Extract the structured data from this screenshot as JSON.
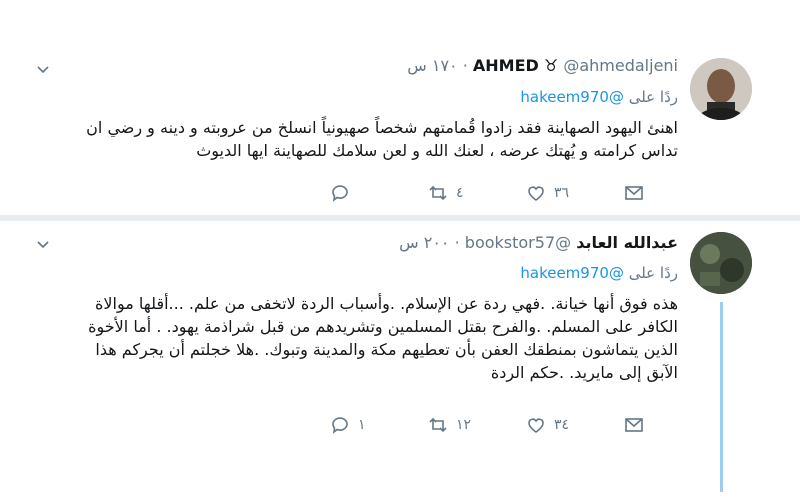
{
  "tweets": [
    {
      "name": "AHMED",
      "handle": "@ahmedaljeni",
      "time": "١٧٠ س",
      "reply_label": "ردًا على",
      "reply_to": "@hakeem970",
      "text": "اهنئ اليهود الصهاينة فقد زادوا قُمامتهم شخصاً صهيونياً انسلخ من عروبته و دينه و رضي ان تداس كرامته و يُهتك عرضه ، لعنك الله و لعن سلامك للصهاينة ايها الديوث",
      "actions": {
        "retweets": "٤",
        "likes": "٣٦"
      }
    },
    {
      "name": "عبدالله العابد",
      "handle": "@bookstor57",
      "time": "٢٠٠ س",
      "reply_label": "ردًا على",
      "reply_to": "@hakeem970",
      "text": "هذه فوق أنها خيانة. .فهي ردة عن الإسلام. .وأسباب الردة لاتخفى من علم. ...أقلها موالاة الكافر على المسلم. .والفرح بقتل المسلمين وتشريدهم من قبل شراذمة يهود. . أما الأخوة الذين يتماشون بمنطقك العفن بأن تعطيهم مكة والمدينة وتبوك. .هلا خجلتم أن يجركم هذا الآبق إلى مايريد. .حكم الردة",
      "actions": {
        "replies": "١",
        "retweets": "١٢",
        "likes": "٣٤"
      }
    }
  ],
  "icons": [
    "chevron-down-icon",
    "reply-icon",
    "retweet-icon",
    "like-icon",
    "message-icon",
    "bull-icon"
  ],
  "colors": {
    "link": "#1b95e0",
    "muted": "#657786",
    "divider": "#e6ecf0",
    "thread": "#9ccdf0"
  }
}
